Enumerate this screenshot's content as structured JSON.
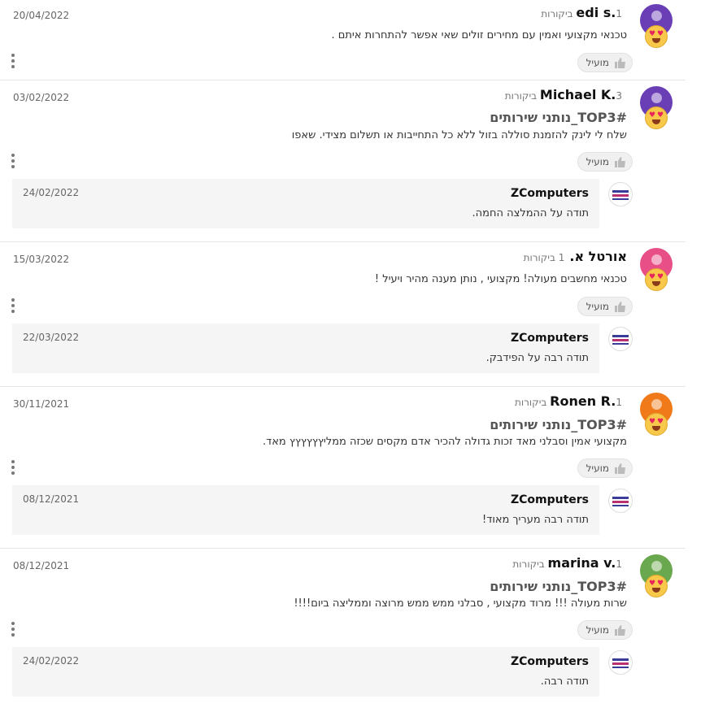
{
  "colors": {
    "avatar_purple": "#6a3fb5",
    "avatar_pink": "#e84f86",
    "avatar_orange": "#f07a1a",
    "avatar_green": "#6aa84f"
  },
  "helpful_label": "מועיל",
  "reviews": [
    {
      "name": "edi s.",
      "count": "1 ביקורות",
      "date": "20/04/2022",
      "tag": "",
      "text": "טכנאי מקצועי ואמין עם מחירים זולים שאי אפשר להתחרות איתם .",
      "avatar_color": "#6a3fb5",
      "reply": null
    },
    {
      "name": "Michael K.",
      "count": "3 ביקורות",
      "date": "03/02/2022",
      "tag": "#TOP3_נותני שירותים",
      "text": "שלח לי לינק להזמנת סוללה בזול ללא כל התחייבות או תשלום מצידי. שאפו",
      "avatar_color": "#6a3fb5",
      "reply": {
        "name": "ZComputers",
        "date": "24/02/2022",
        "text": "תודה על ההמלצה החמה."
      }
    },
    {
      "name": "אורטל א.",
      "count": "1 ביקורות",
      "date": "15/03/2022",
      "tag": "",
      "text": "טכנאי מחשבים מעולה! מקצועי , נותן מענה מהיר ויעיל !",
      "avatar_color": "#e84f86",
      "reply": {
        "name": "ZComputers",
        "date": "22/03/2022",
        "text": "תודה רבה על הפידבק."
      }
    },
    {
      "name": "Ronen R.",
      "count": "1 ביקורות",
      "date": "30/11/2021",
      "tag": "#TOP3_נותני שירותים",
      "text": "מקצועי אמין וסבלני מאד זכות גדולה להכיר אדם מקסים שכזה ממליץץץץץץ מאד.",
      "avatar_color": "#f07a1a",
      "reply": {
        "name": "ZComputers",
        "date": "08/12/2021",
        "text": "תודה רבה מעריך מאוד!"
      }
    },
    {
      "name": "marina v.",
      "count": "1 ביקורות",
      "date": "08/12/2021",
      "tag": "#TOP3_נותני שירותים",
      "text": "שרות מעולה !!! מרוד מקצועי , סבלני ממש ממש מרוצה וממליצה ביום!!!!",
      "avatar_color": "#6aa84f",
      "reply": {
        "name": "ZComputers",
        "date": "24/02/2022",
        "text": "תודה רבה."
      }
    }
  ]
}
